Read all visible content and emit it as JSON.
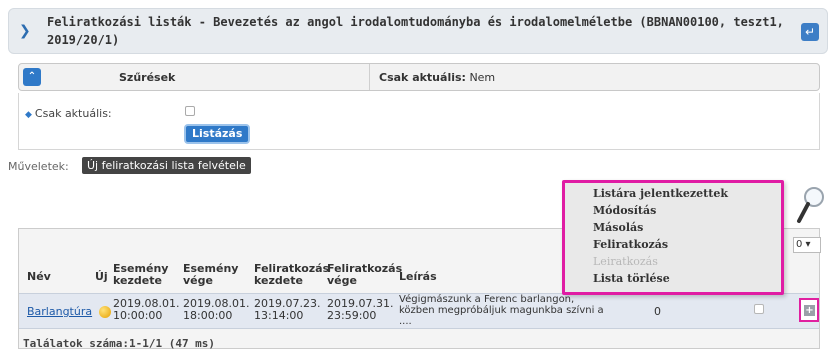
{
  "header": {
    "title": "Feliratkozási listák - Bevezetés az angol irodalomtudományba és irodalomelméletbe (BBNAN00100, teszt1, 2019/20/1)"
  },
  "filter": {
    "label": "Szűrések",
    "summary_label": "Csak aktuális:",
    "summary_value": "Nem",
    "field_label": "Csak aktuális:",
    "list_button": "Listázás"
  },
  "operations": {
    "label": "Műveletek:",
    "new_button": "Új feliratkozási lista felvétele"
  },
  "context_menu": {
    "items": [
      "Listára jelentkezettek",
      "Módosítás",
      "Másolás",
      "Feliratkozás",
      "Leiratkozás",
      "Lista törlése"
    ],
    "disabled_index": 4
  },
  "table": {
    "pager_value": "0",
    "columns": {
      "name": "Név",
      "new": "Új",
      "event_start": "Esemény kezdete",
      "event_end": "Esemény vége",
      "sub_start": "Feliratkozás kezdete",
      "sub_end": "Feliratkozás vége",
      "desc": "Leírás"
    },
    "rows": [
      {
        "name": "Barlangtúra",
        "event_start_date": "2019.08.01.",
        "event_start_time": "10:00:00",
        "event_end_date": "2019.08.01.",
        "event_end_time": "18:00:00",
        "sub_start_date": "2019.07.23.",
        "sub_start_time": "13:14:00",
        "sub_end_date": "2019.07.31.",
        "sub_end_time": "23:59:00",
        "desc1": "Végigmászunk a Ferenc barlangon,",
        "desc2": "közben megpróbáljuk magunkba szívni a",
        "desc3": "....",
        "count": "0"
      }
    ],
    "footer": "Találatok száma:1-1/1 (47 ms)"
  },
  "colors": {
    "accent": "#2f79c8",
    "highlight": "#e01ca4"
  }
}
